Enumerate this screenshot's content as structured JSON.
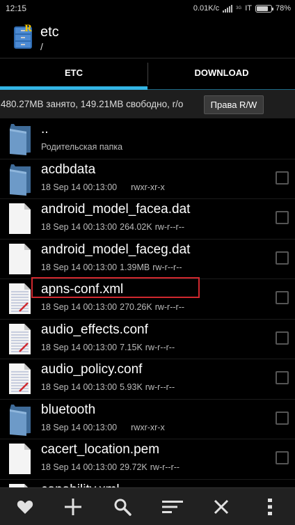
{
  "status_bar": {
    "time": "12:15",
    "speed": "0.01K/c",
    "network": "3G",
    "carrier": "IT",
    "battery": "78%",
    "battery_level": 0.78
  },
  "header": {
    "title": "etc",
    "path": "/"
  },
  "tabs": [
    {
      "label": "ETC",
      "active": true
    },
    {
      "label": "DOWNLOAD",
      "active": false
    }
  ],
  "info_bar": {
    "text": "480.27MB занято, 149.21MB свободно, r/o",
    "button_label": "Права R/W"
  },
  "files": [
    {
      "name": "..",
      "meta": "Родительская папка",
      "size": "",
      "perms": "",
      "type": "folder",
      "checkbox": false
    },
    {
      "name": "acdbdata",
      "meta": "18 Sep 14 00:13:00",
      "size": "",
      "perms": "rwxr-xr-x",
      "type": "folder",
      "checkbox": true
    },
    {
      "name": "android_model_facea.dat",
      "meta": "18 Sep 14 00:13:00",
      "size": "264.02K",
      "perms": "rw-r--r--",
      "type": "file",
      "checkbox": true
    },
    {
      "name": "android_model_faceg.dat",
      "meta": "18 Sep 14 00:13:00",
      "size": "1.39MB",
      "perms": "rw-r--r--",
      "type": "file",
      "checkbox": true
    },
    {
      "name": "apns-conf.xml",
      "meta": "18 Sep 14 00:13:00",
      "size": "270.26K",
      "perms": "rw-r--r--",
      "type": "text",
      "checkbox": true
    },
    {
      "name": "audio_effects.conf",
      "meta": "18 Sep 14 00:13:00",
      "size": "7.15K",
      "perms": "rw-r--r--",
      "type": "text",
      "checkbox": true
    },
    {
      "name": "audio_policy.conf",
      "meta": "18 Sep 14 00:13:00",
      "size": "5.93K",
      "perms": "rw-r--r--",
      "type": "text",
      "checkbox": true
    },
    {
      "name": "bluetooth",
      "meta": "18 Sep 14 00:13:00",
      "size": "",
      "perms": "rwxr-xr-x",
      "type": "folder",
      "checkbox": true
    },
    {
      "name": "cacert_location.pem",
      "meta": "18 Sep 14 00:13:00",
      "size": "29.72K",
      "perms": "rw-r--r--",
      "type": "file",
      "checkbox": true
    },
    {
      "name": "capability.xml",
      "meta": "",
      "size": "",
      "perms": "",
      "type": "text",
      "checkbox": true
    }
  ],
  "toolbar": [
    {
      "icon": "heart-icon"
    },
    {
      "icon": "plus-icon"
    },
    {
      "icon": "search-icon"
    },
    {
      "icon": "sort-icon"
    },
    {
      "icon": "close-icon"
    },
    {
      "icon": "more-vert-icon"
    }
  ],
  "colors": {
    "accent": "#33b5e5",
    "highlight": "#d0282e",
    "folder": "#5b87b5"
  }
}
